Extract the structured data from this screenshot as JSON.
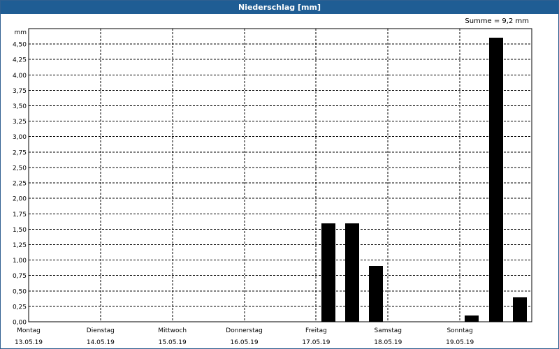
{
  "window": {
    "title": "Niederschlag [mm]"
  },
  "summary": {
    "text": "Summe = 9,2 mm"
  },
  "colors": {
    "titlebar": "#1f5d94",
    "bar": "#000000",
    "grid": "#000000"
  },
  "chart_data": {
    "type": "bar",
    "title": "Niederschlag [mm]",
    "ylabel": "mm",
    "ylim": [
      0,
      4.75
    ],
    "yticks": [
      {
        "v": 0,
        "label": "0,00"
      },
      {
        "v": 0.25,
        "label": "0,25"
      },
      {
        "v": 0.5,
        "label": "0,50"
      },
      {
        "v": 0.75,
        "label": "0,75"
      },
      {
        "v": 1.0,
        "label": "1,00"
      },
      {
        "v": 1.25,
        "label": "1,25"
      },
      {
        "v": 1.5,
        "label": "1,50"
      },
      {
        "v": 1.75,
        "label": "1,75"
      },
      {
        "v": 2.0,
        "label": "2,00"
      },
      {
        "v": 2.25,
        "label": "2,25"
      },
      {
        "v": 2.5,
        "label": "2,50"
      },
      {
        "v": 2.75,
        "label": "2,75"
      },
      {
        "v": 3.0,
        "label": "3,00"
      },
      {
        "v": 3.25,
        "label": "3,25"
      },
      {
        "v": 3.5,
        "label": "3,50"
      },
      {
        "v": 3.75,
        "label": "3,75"
      },
      {
        "v": 4.0,
        "label": "4,00"
      },
      {
        "v": 4.25,
        "label": "4,25"
      },
      {
        "v": 4.5,
        "label": "4,50"
      }
    ],
    "days": [
      {
        "name": "Montag",
        "date": "13.05.19"
      },
      {
        "name": "Dienstag",
        "date": "14.05.19"
      },
      {
        "name": "Mittwoch",
        "date": "15.05.19"
      },
      {
        "name": "Donnerstag",
        "date": "16.05.19"
      },
      {
        "name": "Freitag",
        "date": "17.05.19"
      },
      {
        "name": "Samstag",
        "date": "18.05.19"
      },
      {
        "name": "Sonntag",
        "date": "19.05.19"
      }
    ],
    "bar_unit": "8h",
    "values": [
      0,
      0,
      0,
      0,
      0,
      0,
      0,
      0,
      0,
      0,
      0,
      0,
      1.6,
      1.6,
      0.9,
      0,
      0,
      0,
      0.1,
      4.6,
      0.4
    ],
    "grid": true
  }
}
